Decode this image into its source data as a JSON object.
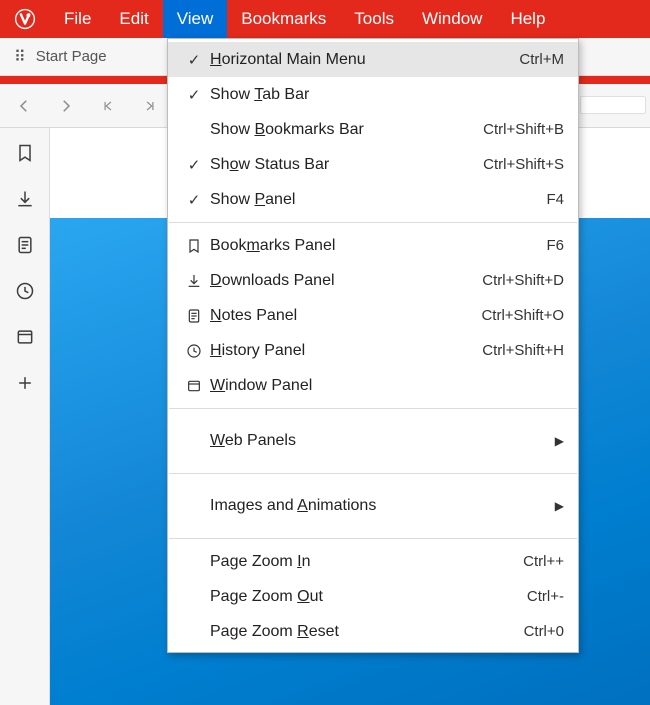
{
  "menubar": {
    "items": [
      {
        "label": "File"
      },
      {
        "label": "Edit"
      },
      {
        "label": "View",
        "active": true
      },
      {
        "label": "Bookmarks"
      },
      {
        "label": "Tools"
      },
      {
        "label": "Window"
      },
      {
        "label": "Help"
      }
    ]
  },
  "tabstrip": {
    "start_page_label": "Start Page"
  },
  "side_panel": {
    "items": [
      {
        "name": "bookmarks",
        "icon": "bookmark-icon"
      },
      {
        "name": "downloads",
        "icon": "download-icon"
      },
      {
        "name": "notes",
        "icon": "notes-icon"
      },
      {
        "name": "history",
        "icon": "history-icon"
      },
      {
        "name": "window",
        "icon": "window-icon"
      },
      {
        "name": "add",
        "icon": "plus-icon"
      }
    ]
  },
  "view_menu": {
    "groups": [
      [
        {
          "checked": true,
          "label": "Horizontal Main Menu",
          "mnemonic_index": 0,
          "accel": "Ctrl+M",
          "highlight": true
        },
        {
          "checked": true,
          "label": "Show Tab Bar",
          "mnemonic_index": 5,
          "accel": ""
        },
        {
          "checked": false,
          "label": "Show Bookmarks Bar",
          "mnemonic_index": 5,
          "accel": "Ctrl+Shift+B"
        },
        {
          "checked": true,
          "label": "Show Status Bar",
          "mnemonic_index": 2,
          "accel": "Ctrl+Shift+S"
        },
        {
          "checked": true,
          "label": "Show Panel",
          "mnemonic_index": 5,
          "accel": "F4"
        }
      ],
      [
        {
          "icon": "bookmark-icon",
          "label": "Bookmarks Panel",
          "mnemonic_index": 4,
          "accel": "F6"
        },
        {
          "icon": "download-icon",
          "label": "Downloads Panel",
          "mnemonic_index": 0,
          "accel": "Ctrl+Shift+D"
        },
        {
          "icon": "notes-icon",
          "label": "Notes Panel",
          "mnemonic_index": 0,
          "accel": "Ctrl+Shift+O"
        },
        {
          "icon": "history-icon",
          "label": "History Panel",
          "mnemonic_index": 0,
          "accel": "Ctrl+Shift+H"
        },
        {
          "icon": "window-icon",
          "label": "Window Panel",
          "mnemonic_index": 0,
          "accel": ""
        }
      ],
      [
        {
          "label": "Web Panels",
          "mnemonic_index": 0,
          "submenu": true,
          "tall": true
        }
      ],
      [
        {
          "label": "Images and Animations",
          "mnemonic_index": 11,
          "submenu": true,
          "tall": true
        }
      ],
      [
        {
          "label": "Page Zoom In",
          "mnemonic_index": 10,
          "accel": "Ctrl++"
        },
        {
          "label": "Page Zoom Out",
          "mnemonic_index": 10,
          "accel": "Ctrl+-"
        },
        {
          "label": "Page Zoom Reset",
          "mnemonic_index": 10,
          "accel": "Ctrl+0"
        }
      ]
    ]
  }
}
